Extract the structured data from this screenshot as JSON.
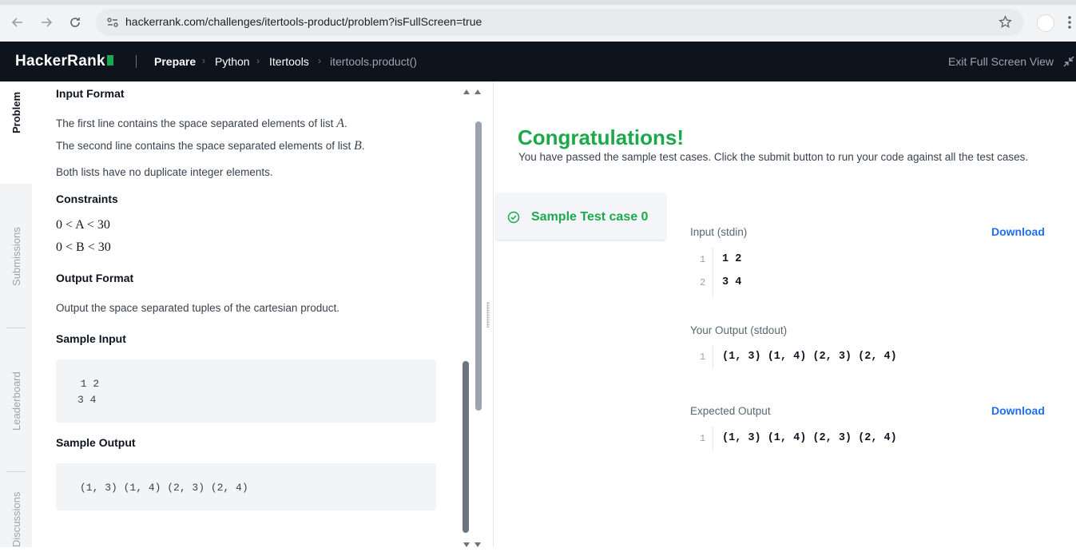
{
  "browser": {
    "url": "hackerrank.com/challenges/itertools-product/problem?isFullScreen=true"
  },
  "header": {
    "logo": "HackerRank",
    "breadcrumbs": [
      "Prepare",
      "Python",
      "Itertools",
      "itertools.product()"
    ],
    "exit_full_screen": "Exit Full Screen View"
  },
  "side_tabs": [
    "Problem",
    "Submissions",
    "Leaderboard",
    "Discussions"
  ],
  "problem": {
    "input_format": {
      "heading": "Input Format",
      "line1_text": "The first line contains the space separated elements of list ",
      "line1_var": "A",
      "line2_text": "The second line contains the space separated elements of list ",
      "line2_var": "B",
      "line3": "Both lists have no duplicate integer elements."
    },
    "constraints": {
      "heading": "Constraints",
      "c1": "0 < A < 30",
      "c2": "0 < B < 30"
    },
    "output_format": {
      "heading": "Output Format",
      "text": "Output the space separated tuples of the cartesian product."
    },
    "sample_input": {
      "heading": "Sample Input",
      "lines": [
        " 1 2",
        "3 4"
      ]
    },
    "sample_output": {
      "heading": "Sample Output",
      "text": "(1, 3) (1, 4) (2, 3) (2, 4)"
    }
  },
  "results": {
    "title": "Congratulations!",
    "subtitle": "You have passed the sample test cases. Click the submit button to run your code against all the test cases.",
    "test_case_label": "Sample Test case 0",
    "input_label": "Input (stdin)",
    "download_label": "Download",
    "input_lines": [
      {
        "n": "1",
        "text": "1 2"
      },
      {
        "n": "2",
        "text": "3 4"
      }
    ],
    "your_output_label": "Your Output (stdout)",
    "your_output": {
      "n": "1",
      "text": "(1, 3) (1, 4) (2, 3) (2, 4)"
    },
    "expected_output_label": "Expected Output",
    "expected_output": {
      "n": "1",
      "text": "(1, 3) (1, 4) (2, 3) (2, 4)"
    }
  },
  "colors": {
    "success": "#1ba94c",
    "header_bg": "#0e141e",
    "link": "#1f6feb"
  }
}
